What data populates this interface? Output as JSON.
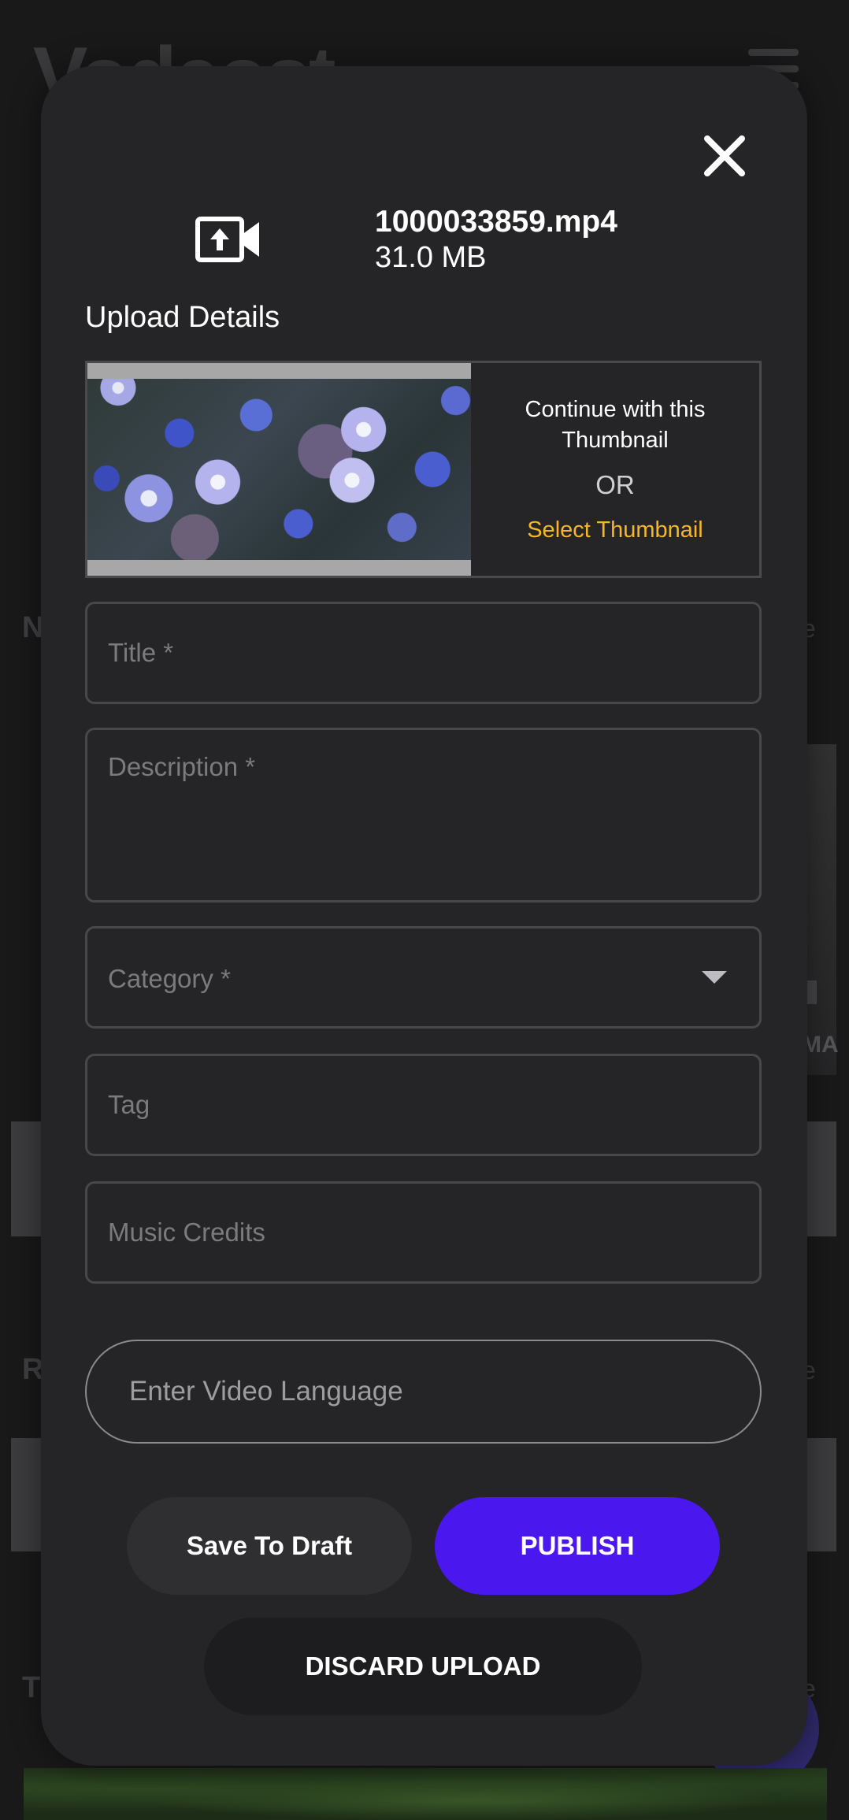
{
  "background": {
    "logo_text": "Vodeost",
    "section_letters": [
      "N",
      "R",
      "T"
    ],
    "more_label": "e",
    "card_text": "MA"
  },
  "modal": {
    "file": {
      "name": "1000033859.mp4",
      "size": "31.0 MB",
      "icon": "video-upload-icon"
    },
    "close_icon": "close-icon",
    "section_title": "Upload Details",
    "thumbnail": {
      "continue_text": "Continue with this Thumbnail",
      "or_text": "OR",
      "select_text": "Select Thumbnail"
    },
    "form": {
      "title_placeholder": "Title *",
      "description_placeholder": "Description *",
      "category_placeholder": "Category *",
      "tag_placeholder": "Tag",
      "music_credits_placeholder": "Music Credits",
      "language_placeholder": "Enter Video Language"
    },
    "buttons": {
      "save_draft": "Save To Draft",
      "publish": "PUBLISH",
      "discard": "DISCARD UPLOAD"
    }
  },
  "colors": {
    "accent": "#4a17ef",
    "link": "#f5b629",
    "modal_bg": "#252426"
  }
}
